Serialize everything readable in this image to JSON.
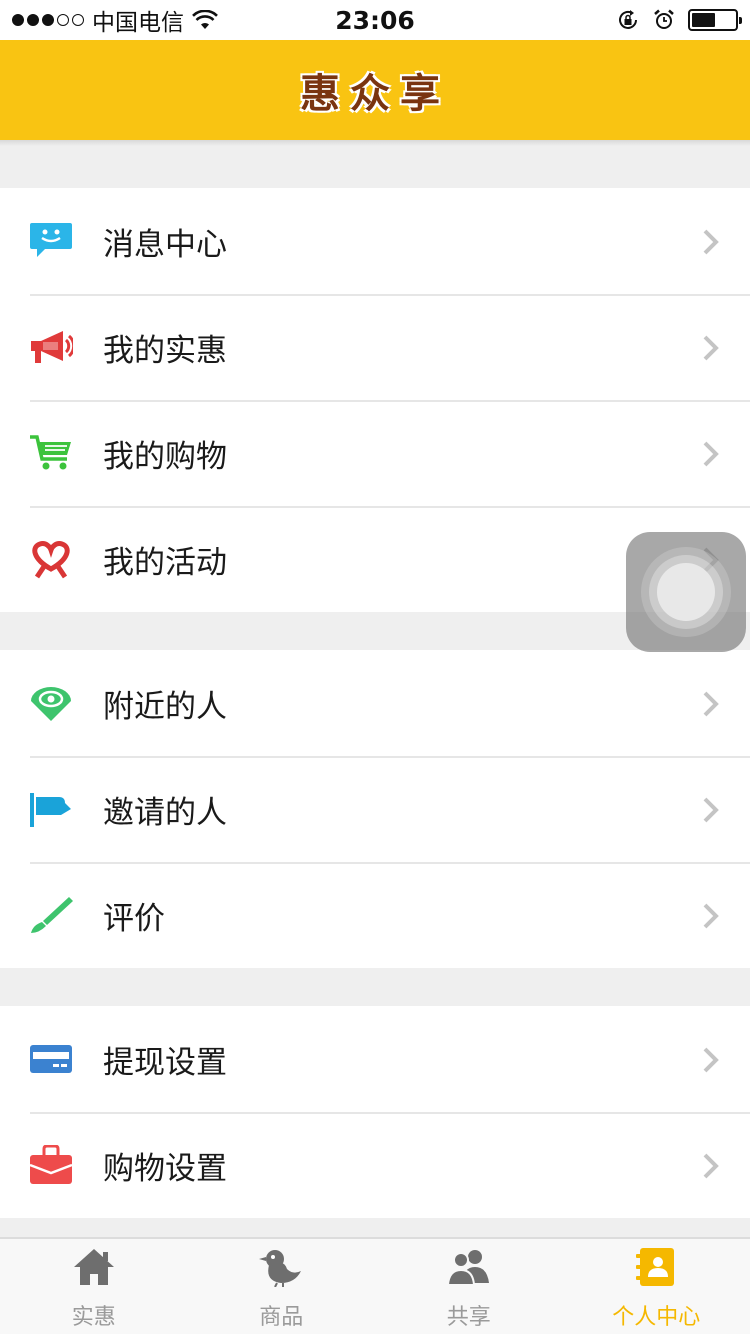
{
  "status_bar": {
    "carrier": "中国电信",
    "time": "23:06",
    "signal_bars_filled": 3,
    "signal_bars_total": 5,
    "battery_level": 0.55
  },
  "header": {
    "title": "惠众享"
  },
  "groups": [
    {
      "items": [
        {
          "label": "消息中心",
          "icon": "message-icon",
          "color": "#2bb5e8"
        },
        {
          "label": "我的实惠",
          "icon": "megaphone-icon",
          "color": "#e03a3a"
        },
        {
          "label": "我的购物",
          "icon": "cart-icon",
          "color": "#3cc33c"
        },
        {
          "label": "我的活动",
          "icon": "heart-ribbon-icon",
          "color": "#d93636"
        }
      ]
    },
    {
      "items": [
        {
          "label": "附近的人",
          "icon": "location-eye-icon",
          "color": "#3ec46d"
        },
        {
          "label": "邀请的人",
          "icon": "flag-icon",
          "color": "#1aa3d9"
        },
        {
          "label": "评价",
          "icon": "brush-icon",
          "color": "#3ec46d"
        }
      ]
    },
    {
      "items": [
        {
          "label": "提现设置",
          "icon": "card-icon",
          "color": "#3b82d0"
        },
        {
          "label": "购物设置",
          "icon": "bag-icon",
          "color": "#ee4b4b"
        }
      ]
    }
  ],
  "tabs": [
    {
      "label": "实惠",
      "icon": "home-icon",
      "active": false
    },
    {
      "label": "商品",
      "icon": "bird-icon",
      "active": false
    },
    {
      "label": "共享",
      "icon": "users-icon",
      "active": false
    },
    {
      "label": "个人中心",
      "icon": "contact-book-icon",
      "active": true
    }
  ],
  "colors": {
    "accent": "#f9c412",
    "title_text": "#7a3410",
    "active_tab": "#f5b800",
    "inactive_tab": "#9a9a9a"
  }
}
